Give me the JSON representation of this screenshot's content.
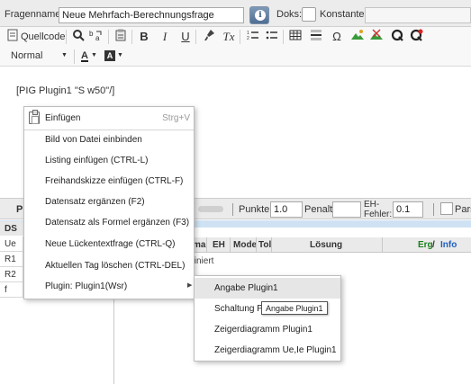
{
  "question_bar": {
    "name_label": "Fragenname:",
    "name_value": "Neue Mehrfach-Berechnungsfrage",
    "info_icon": "i",
    "doks_label": "Doks:",
    "konstante_label": "Konstante:"
  },
  "toolbar": {
    "source_label": "Quellcode",
    "bold": "B",
    "italic": "I",
    "underline": "U",
    "clear_format": "Tx",
    "omega": "Ω",
    "format_select": "Normal",
    "font_color": "A",
    "bg_color": "A"
  },
  "editor": {
    "content": "[PIG Plugin1 \"S w50\"/]"
  },
  "lower": {
    "button_fragment": "Pl",
    "punkte_label": "Punkte:",
    "punkte_value": "1.0",
    "penalt_label": "Penalt:",
    "eh_label_1": "EH-",
    "eh_label_2": "Fehler:",
    "eh_value": "0.1",
    "pars_label": "Pars",
    "ds_header": "DS",
    "left_rows": [
      "Ue",
      "R1",
      "R2",
      "f"
    ],
    "col_headers": {
      "ma": "ma",
      "eh": "EH",
      "mode": "Mode",
      "tol": "Tol",
      "loesung": "Lösung",
      "erg": "Erg",
      "slash": " / ",
      "info": "Info"
    },
    "row_text": "finiert"
  },
  "context_menu": {
    "items": [
      {
        "label": "Einfügen",
        "shortcut": "Strg+V"
      },
      {
        "label": "Bild von Datei einbinden"
      },
      {
        "label": "Listing einfügen (CTRL-L)"
      },
      {
        "label": "Freihandskizze einfügen (CTRL-F)"
      },
      {
        "label": "Datensatz ergänzen (F2)"
      },
      {
        "label": "Datensatz als Formel ergänzen (F3)"
      },
      {
        "label": "Neue Lückentextfrage (CTRL-Q)"
      },
      {
        "label": "Aktuellen Tag löschen (CTRL-DEL)"
      },
      {
        "label": "Plugin: Plugin1(Wsr)",
        "arrow": "▶"
      }
    ]
  },
  "submenu": {
    "items": [
      {
        "label": "Angabe Plugin1"
      },
      {
        "label": "Schaltung P"
      },
      {
        "label": "Zeigerdiagramm Plugin1"
      },
      {
        "label": "Zeigerdiagramm Ue,Ie Plugin1"
      }
    ]
  },
  "tooltip": "Angabe Plugin1"
}
